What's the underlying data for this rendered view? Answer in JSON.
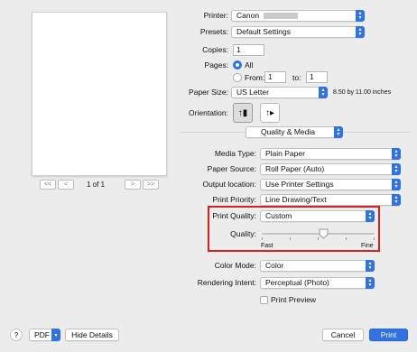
{
  "preview": {
    "page_indicator": "1 of 1",
    "nav_first": "<<",
    "nav_prev": "<",
    "nav_next": ">",
    "nav_last": ">>"
  },
  "printer": {
    "label": "Printer:",
    "value": "Canon"
  },
  "presets": {
    "label": "Presets:",
    "value": "Default Settings"
  },
  "copies": {
    "label": "Copies:",
    "value": "1"
  },
  "pages": {
    "label": "Pages:",
    "all_label": "All",
    "from_label": "From:",
    "from_value": "1",
    "to_label": "to:",
    "to_value": "1"
  },
  "paper_size": {
    "label": "Paper Size:",
    "value": "US Letter",
    "dimensions": "8.50 by 11.00 inches"
  },
  "orientation": {
    "label": "Orientation:"
  },
  "section": {
    "value": "Quality & Media"
  },
  "media_type": {
    "label": "Media Type:",
    "value": "Plain Paper"
  },
  "paper_source": {
    "label": "Paper Source:",
    "value": "Roll Paper (Auto)"
  },
  "output_location": {
    "label": "Output location:",
    "value": "Use Printer Settings"
  },
  "print_priority": {
    "label": "Print Priority:",
    "value": "Line Drawing/Text"
  },
  "print_quality": {
    "label": "Print Quality:",
    "value": "Custom"
  },
  "quality": {
    "label": "Quality:",
    "min_label": "Fast",
    "max_label": "Fine",
    "level": 0.55
  },
  "color_mode": {
    "label": "Color Mode:",
    "value": "Color"
  },
  "rendering_intent": {
    "label": "Rendering Intent:",
    "value": "Perceptual (Photo)"
  },
  "print_preview": {
    "label": "Print Preview"
  },
  "footer": {
    "help": "?",
    "pdf": "PDF",
    "hide_details": "Hide Details",
    "cancel": "Cancel",
    "print": "Print"
  },
  "colors": {
    "accent": "#2f72e4",
    "highlight_border": "#d82020"
  }
}
